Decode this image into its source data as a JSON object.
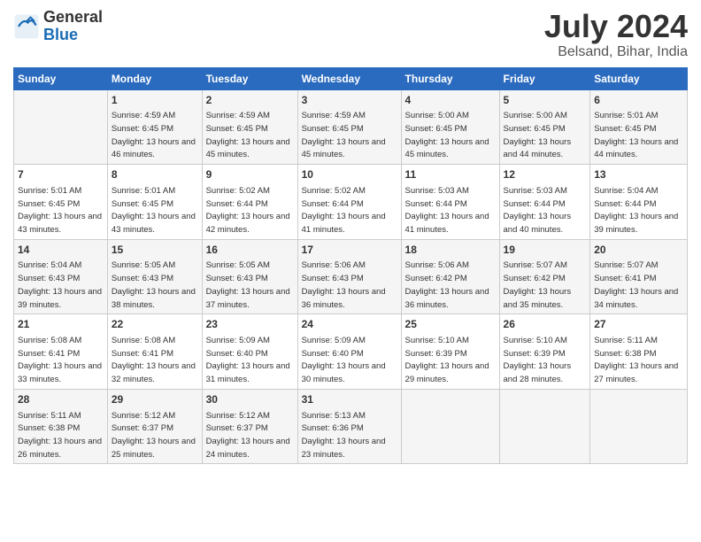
{
  "logo": {
    "general": "General",
    "blue": "Blue"
  },
  "title": "July 2024",
  "subtitle": "Belsand, Bihar, India",
  "columns": [
    "Sunday",
    "Monday",
    "Tuesday",
    "Wednesday",
    "Thursday",
    "Friday",
    "Saturday"
  ],
  "weeks": [
    [
      {
        "day": "",
        "sunrise": "",
        "sunset": "",
        "daylight": ""
      },
      {
        "day": "1",
        "sunrise": "Sunrise: 4:59 AM",
        "sunset": "Sunset: 6:45 PM",
        "daylight": "Daylight: 13 hours and 46 minutes."
      },
      {
        "day": "2",
        "sunrise": "Sunrise: 4:59 AM",
        "sunset": "Sunset: 6:45 PM",
        "daylight": "Daylight: 13 hours and 45 minutes."
      },
      {
        "day": "3",
        "sunrise": "Sunrise: 4:59 AM",
        "sunset": "Sunset: 6:45 PM",
        "daylight": "Daylight: 13 hours and 45 minutes."
      },
      {
        "day": "4",
        "sunrise": "Sunrise: 5:00 AM",
        "sunset": "Sunset: 6:45 PM",
        "daylight": "Daylight: 13 hours and 45 minutes."
      },
      {
        "day": "5",
        "sunrise": "Sunrise: 5:00 AM",
        "sunset": "Sunset: 6:45 PM",
        "daylight": "Daylight: 13 hours and 44 minutes."
      },
      {
        "day": "6",
        "sunrise": "Sunrise: 5:01 AM",
        "sunset": "Sunset: 6:45 PM",
        "daylight": "Daylight: 13 hours and 44 minutes."
      }
    ],
    [
      {
        "day": "7",
        "sunrise": "Sunrise: 5:01 AM",
        "sunset": "Sunset: 6:45 PM",
        "daylight": "Daylight: 13 hours and 43 minutes."
      },
      {
        "day": "8",
        "sunrise": "Sunrise: 5:01 AM",
        "sunset": "Sunset: 6:45 PM",
        "daylight": "Daylight: 13 hours and 43 minutes."
      },
      {
        "day": "9",
        "sunrise": "Sunrise: 5:02 AM",
        "sunset": "Sunset: 6:44 PM",
        "daylight": "Daylight: 13 hours and 42 minutes."
      },
      {
        "day": "10",
        "sunrise": "Sunrise: 5:02 AM",
        "sunset": "Sunset: 6:44 PM",
        "daylight": "Daylight: 13 hours and 41 minutes."
      },
      {
        "day": "11",
        "sunrise": "Sunrise: 5:03 AM",
        "sunset": "Sunset: 6:44 PM",
        "daylight": "Daylight: 13 hours and 41 minutes."
      },
      {
        "day": "12",
        "sunrise": "Sunrise: 5:03 AM",
        "sunset": "Sunset: 6:44 PM",
        "daylight": "Daylight: 13 hours and 40 minutes."
      },
      {
        "day": "13",
        "sunrise": "Sunrise: 5:04 AM",
        "sunset": "Sunset: 6:44 PM",
        "daylight": "Daylight: 13 hours and 39 minutes."
      }
    ],
    [
      {
        "day": "14",
        "sunrise": "Sunrise: 5:04 AM",
        "sunset": "Sunset: 6:43 PM",
        "daylight": "Daylight: 13 hours and 39 minutes."
      },
      {
        "day": "15",
        "sunrise": "Sunrise: 5:05 AM",
        "sunset": "Sunset: 6:43 PM",
        "daylight": "Daylight: 13 hours and 38 minutes."
      },
      {
        "day": "16",
        "sunrise": "Sunrise: 5:05 AM",
        "sunset": "Sunset: 6:43 PM",
        "daylight": "Daylight: 13 hours and 37 minutes."
      },
      {
        "day": "17",
        "sunrise": "Sunrise: 5:06 AM",
        "sunset": "Sunset: 6:43 PM",
        "daylight": "Daylight: 13 hours and 36 minutes."
      },
      {
        "day": "18",
        "sunrise": "Sunrise: 5:06 AM",
        "sunset": "Sunset: 6:42 PM",
        "daylight": "Daylight: 13 hours and 36 minutes."
      },
      {
        "day": "19",
        "sunrise": "Sunrise: 5:07 AM",
        "sunset": "Sunset: 6:42 PM",
        "daylight": "Daylight: 13 hours and 35 minutes."
      },
      {
        "day": "20",
        "sunrise": "Sunrise: 5:07 AM",
        "sunset": "Sunset: 6:41 PM",
        "daylight": "Daylight: 13 hours and 34 minutes."
      }
    ],
    [
      {
        "day": "21",
        "sunrise": "Sunrise: 5:08 AM",
        "sunset": "Sunset: 6:41 PM",
        "daylight": "Daylight: 13 hours and 33 minutes."
      },
      {
        "day": "22",
        "sunrise": "Sunrise: 5:08 AM",
        "sunset": "Sunset: 6:41 PM",
        "daylight": "Daylight: 13 hours and 32 minutes."
      },
      {
        "day": "23",
        "sunrise": "Sunrise: 5:09 AM",
        "sunset": "Sunset: 6:40 PM",
        "daylight": "Daylight: 13 hours and 31 minutes."
      },
      {
        "day": "24",
        "sunrise": "Sunrise: 5:09 AM",
        "sunset": "Sunset: 6:40 PM",
        "daylight": "Daylight: 13 hours and 30 minutes."
      },
      {
        "day": "25",
        "sunrise": "Sunrise: 5:10 AM",
        "sunset": "Sunset: 6:39 PM",
        "daylight": "Daylight: 13 hours and 29 minutes."
      },
      {
        "day": "26",
        "sunrise": "Sunrise: 5:10 AM",
        "sunset": "Sunset: 6:39 PM",
        "daylight": "Daylight: 13 hours and 28 minutes."
      },
      {
        "day": "27",
        "sunrise": "Sunrise: 5:11 AM",
        "sunset": "Sunset: 6:38 PM",
        "daylight": "Daylight: 13 hours and 27 minutes."
      }
    ],
    [
      {
        "day": "28",
        "sunrise": "Sunrise: 5:11 AM",
        "sunset": "Sunset: 6:38 PM",
        "daylight": "Daylight: 13 hours and 26 minutes."
      },
      {
        "day": "29",
        "sunrise": "Sunrise: 5:12 AM",
        "sunset": "Sunset: 6:37 PM",
        "daylight": "Daylight: 13 hours and 25 minutes."
      },
      {
        "day": "30",
        "sunrise": "Sunrise: 5:12 AM",
        "sunset": "Sunset: 6:37 PM",
        "daylight": "Daylight: 13 hours and 24 minutes."
      },
      {
        "day": "31",
        "sunrise": "Sunrise: 5:13 AM",
        "sunset": "Sunset: 6:36 PM",
        "daylight": "Daylight: 13 hours and 23 minutes."
      },
      {
        "day": "",
        "sunrise": "",
        "sunset": "",
        "daylight": ""
      },
      {
        "day": "",
        "sunrise": "",
        "sunset": "",
        "daylight": ""
      },
      {
        "day": "",
        "sunrise": "",
        "sunset": "",
        "daylight": ""
      }
    ]
  ]
}
